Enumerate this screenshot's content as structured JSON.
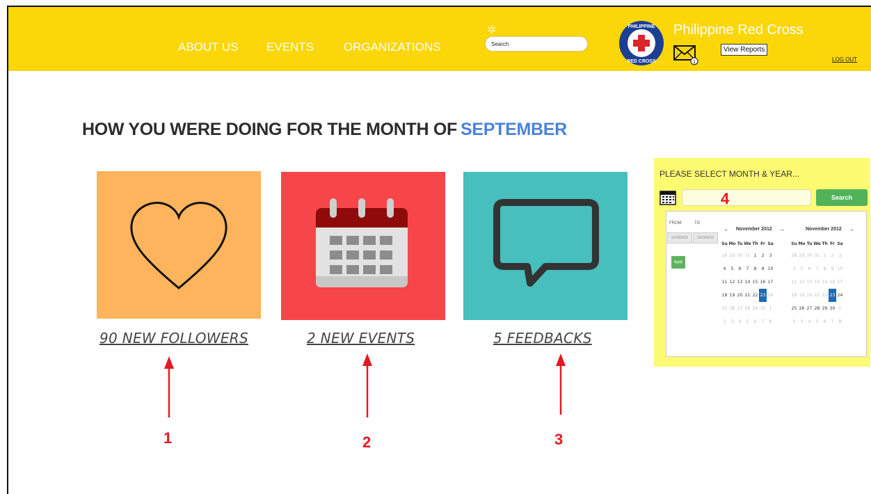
{
  "nav": {
    "items": [
      "ABOUT US",
      "EVENTS",
      "ORGANIZATIONS"
    ],
    "search_placeholder": "Search",
    "brand": "Philippine Red Cross",
    "logo_text": "PHILIPPINE RED CROSS",
    "mail_count": "1",
    "view_reports": "View Reports",
    "logout": "LOG OUT"
  },
  "heading": {
    "prefix": "HOW YOU WERE DOING FOR THE MONTH OF",
    "month": "SEPTEMBER"
  },
  "cards": [
    {
      "label": "90 NEW FOLLOWERS",
      "number": "1",
      "color": "#fdb45c",
      "icon": "heart-icon"
    },
    {
      "label": "2 NEW EVENTS",
      "number": "2",
      "color": "#f7464a",
      "icon": "calendar-icon"
    },
    {
      "label": "5 FEEDBACKS",
      "number": "3",
      "color": "#46bfbd",
      "icon": "speech-bubble-icon"
    }
  ],
  "date_panel": {
    "title": "PLEASE SELECT MONTH & YEAR...",
    "search_label": "Search",
    "number": "4",
    "from_label": "FROM",
    "to_label": "TO",
    "from_value": "11/23/2012",
    "to_value": "11/23/2012",
    "apply_label": "Apply",
    "calendars": [
      {
        "month": "November 2012",
        "weeks": [
          [
            "28",
            "29",
            "30",
            "31",
            "1",
            "2",
            "3"
          ],
          [
            "4",
            "5",
            "6",
            "7",
            "8",
            "9",
            "10"
          ],
          [
            "11",
            "12",
            "13",
            "14",
            "15",
            "16",
            "17"
          ],
          [
            "18",
            "19",
            "20",
            "21",
            "22",
            "23",
            "24"
          ],
          [
            "25",
            "26",
            "27",
            "28",
            "29",
            "30",
            "1"
          ],
          [
            "2",
            "3",
            "4",
            "5",
            "6",
            "7",
            "8"
          ]
        ]
      },
      {
        "month": "November 2012",
        "weeks": [
          [
            "28",
            "29",
            "30",
            "31",
            "1",
            "2",
            "3"
          ],
          [
            "4",
            "5",
            "6",
            "7",
            "8",
            "9",
            "10"
          ],
          [
            "11",
            "12",
            "13",
            "14",
            "15",
            "16",
            "17"
          ],
          [
            "18",
            "19",
            "20",
            "21",
            "22",
            "23",
            "24"
          ],
          [
            "25",
            "26",
            "27",
            "28",
            "29",
            "30",
            "1"
          ],
          [
            "2",
            "3",
            "4",
            "5",
            "6",
            "7",
            "8"
          ]
        ]
      }
    ],
    "weekdays": [
      "Su",
      "Mo",
      "Tu",
      "We",
      "Th",
      "Fr",
      "Sa"
    ],
    "selected_day": "23"
  },
  "colors": {
    "topbar": "#fbd608",
    "accent_month": "#4b83d9",
    "annotation": "#e21a23",
    "panel": "#fdfb72"
  }
}
